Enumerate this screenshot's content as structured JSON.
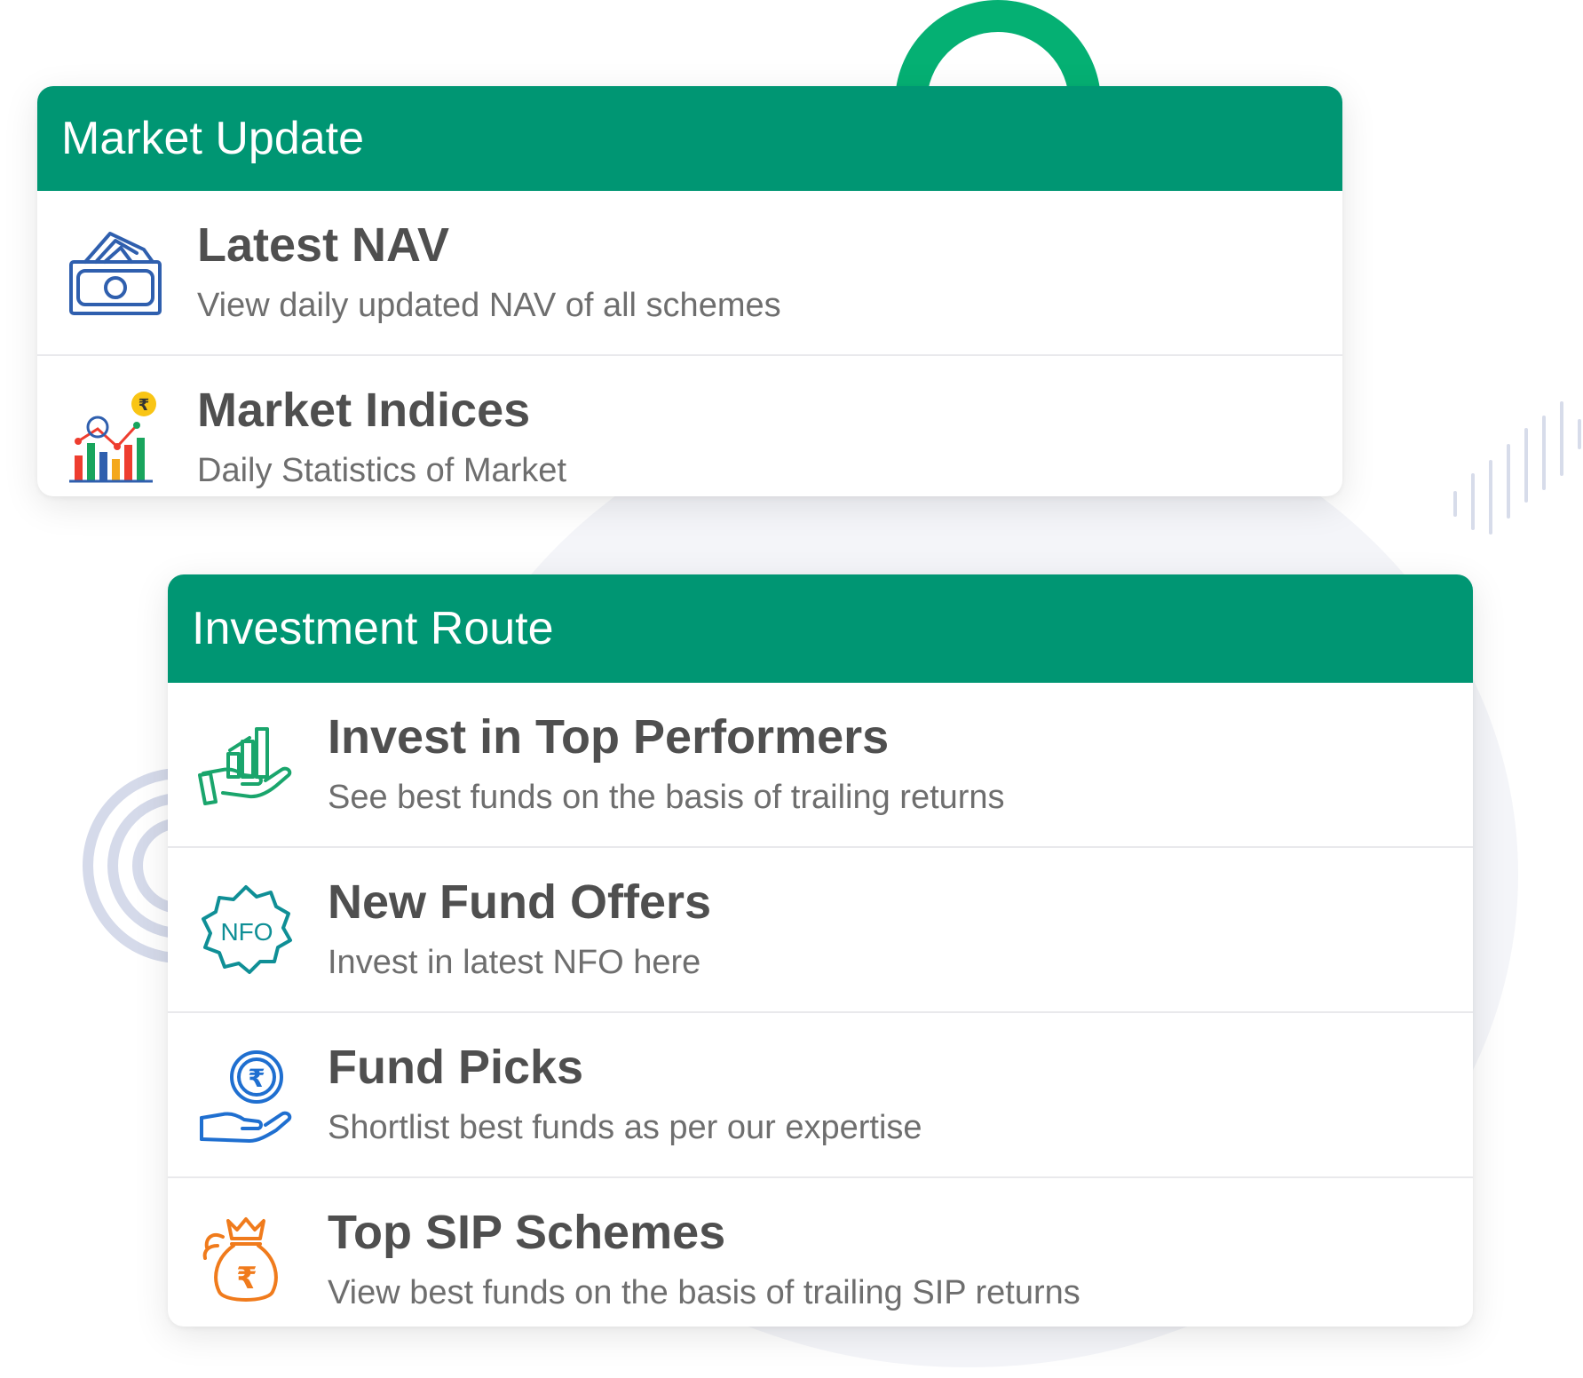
{
  "market_update": {
    "title": "Market Update",
    "items": [
      {
        "icon": "money-stack-icon",
        "title": "Latest NAV",
        "description": "View daily updated NAV of all schemes"
      },
      {
        "icon": "market-chart-icon",
        "title": "Market Indices",
        "description": "Daily Statistics of Market"
      }
    ]
  },
  "investment_route": {
    "title": "Investment Route",
    "items": [
      {
        "icon": "hand-growth-chart-icon",
        "title": "Invest in Top Performers",
        "description": "See best funds on the basis of trailing returns"
      },
      {
        "icon": "nfo-badge-icon",
        "title": "New Fund Offers",
        "description": "Invest in latest NFO here"
      },
      {
        "icon": "hand-rupee-coin-icon",
        "title": "Fund Picks",
        "description": "Shortlist best funds as per our expertise"
      },
      {
        "icon": "rupee-money-bag-icon",
        "title": "Top SIP Schemes",
        "description": "View best funds on the basis of trailing SIP returns"
      }
    ]
  },
  "icon_text": {
    "nfo": "NFO",
    "rupee": "₹"
  },
  "colors": {
    "header_green": "#009673",
    "accent_green": "#05b073",
    "title_text": "#4f4f4f",
    "description_text": "#6e6e6e",
    "icon_blue": "#2f5fae",
    "icon_teal": "#0f8f96",
    "icon_orange": "#f07b1c"
  }
}
